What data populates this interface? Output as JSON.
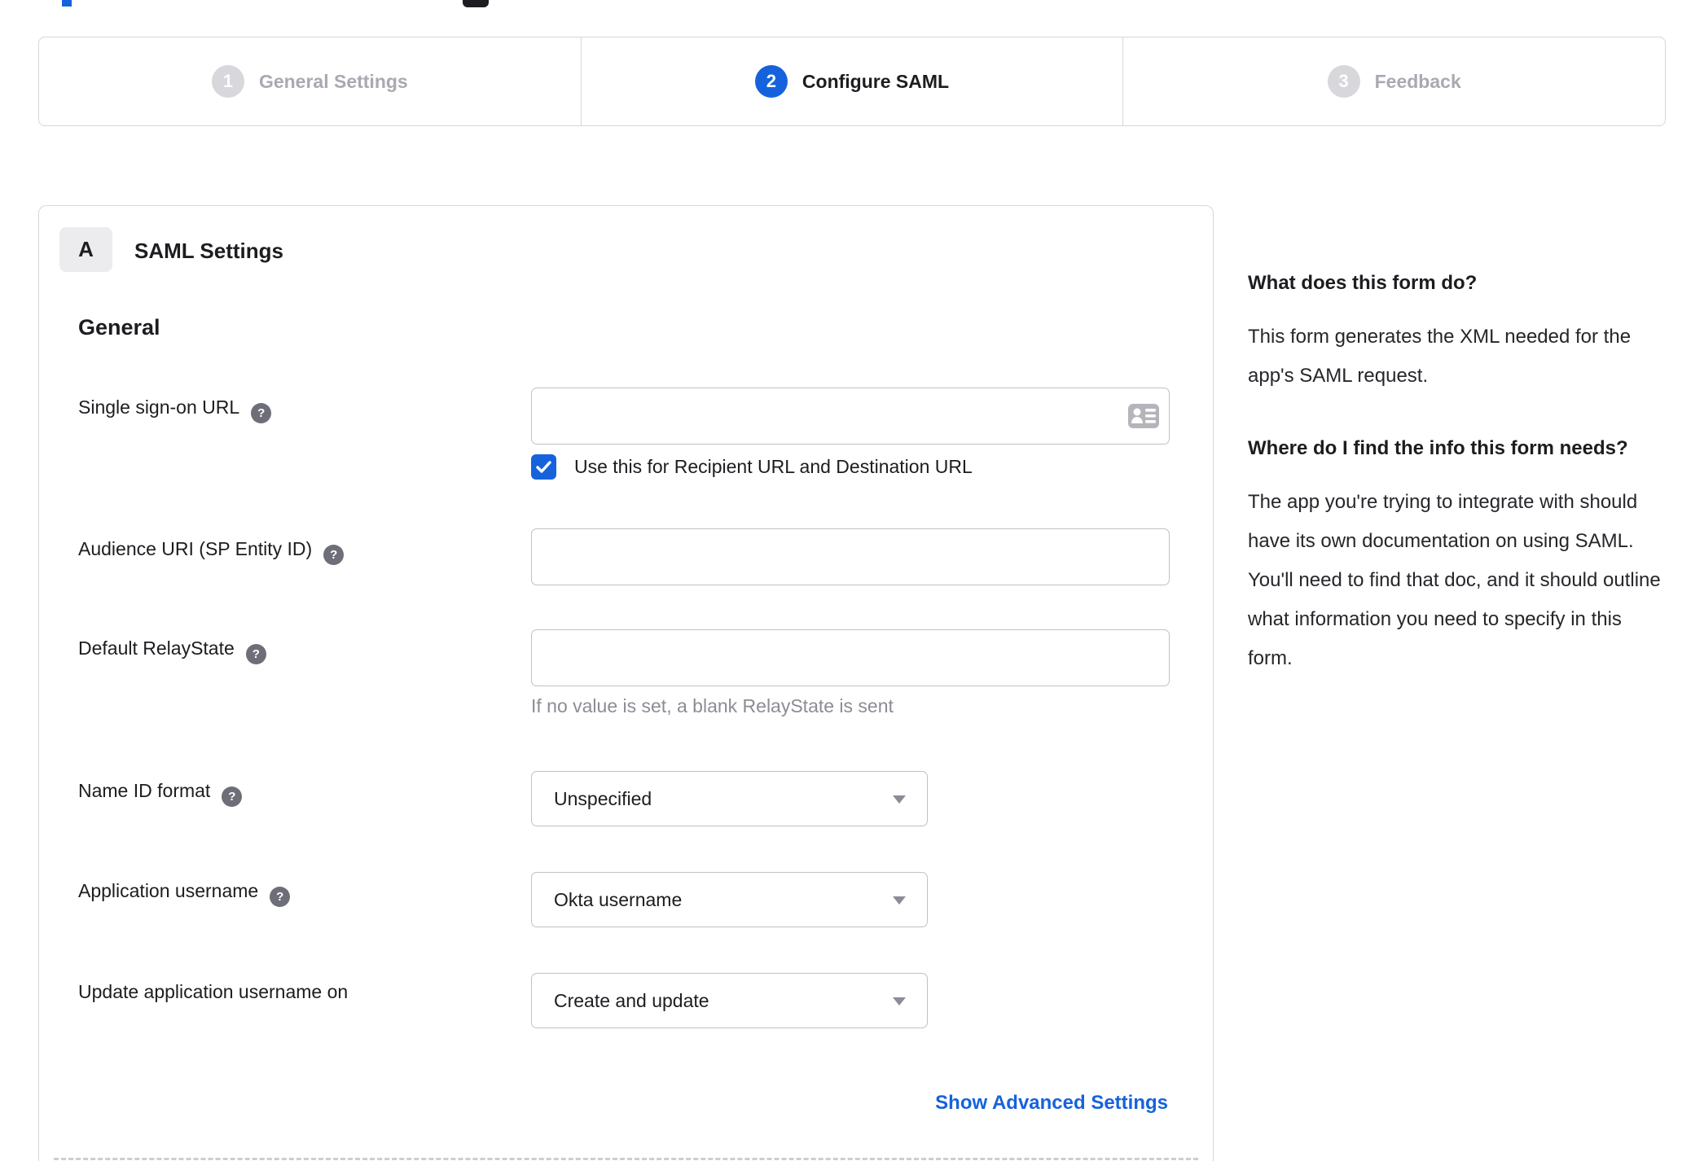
{
  "colors": {
    "accent_blue": "#1662dd",
    "border_gray": "#d7d7dc",
    "input_border": "#c0c0c7",
    "inactive_gray": "#a9a9b2",
    "hint_gray": "#8c8c96",
    "help_icon_bg": "#6e6e78",
    "text_dark": "#1d1d21"
  },
  "stepper": {
    "steps": [
      {
        "number": "1",
        "label": "General Settings",
        "state": "inactive"
      },
      {
        "number": "2",
        "label": "Configure SAML",
        "state": "active"
      },
      {
        "number": "3",
        "label": "Feedback",
        "state": "inactive"
      }
    ]
  },
  "panel": {
    "badge": "A",
    "title": "SAML Settings",
    "section_title": "General",
    "fields": {
      "sso_url": {
        "label": "Single sign-on URL",
        "value": "",
        "icon": "contact-card-icon",
        "checkbox": {
          "checked": true,
          "label": "Use this for Recipient URL and Destination URL"
        }
      },
      "audience_uri": {
        "label": "Audience URI (SP Entity ID)",
        "value": ""
      },
      "relay_state": {
        "label": "Default RelayState",
        "value": "",
        "hint": "If no value is set, a blank RelayState is sent"
      },
      "name_id_format": {
        "label": "Name ID format",
        "value": "Unspecified"
      },
      "app_username": {
        "label": "Application username",
        "value": "Okta username"
      },
      "update_username": {
        "label": "Update application username on",
        "value": "Create and update"
      }
    },
    "advanced_link": "Show Advanced Settings"
  },
  "sidebar": {
    "sections": [
      {
        "heading": "What does this form do?",
        "body": "This form generates the XML needed for the app's SAML request."
      },
      {
        "heading": "Where do I find the info this form needs?",
        "body": "The app you're trying to integrate with should have its own documentation on using SAML. You'll need to find that doc, and it should outline what information you need to specify in this form."
      }
    ]
  }
}
